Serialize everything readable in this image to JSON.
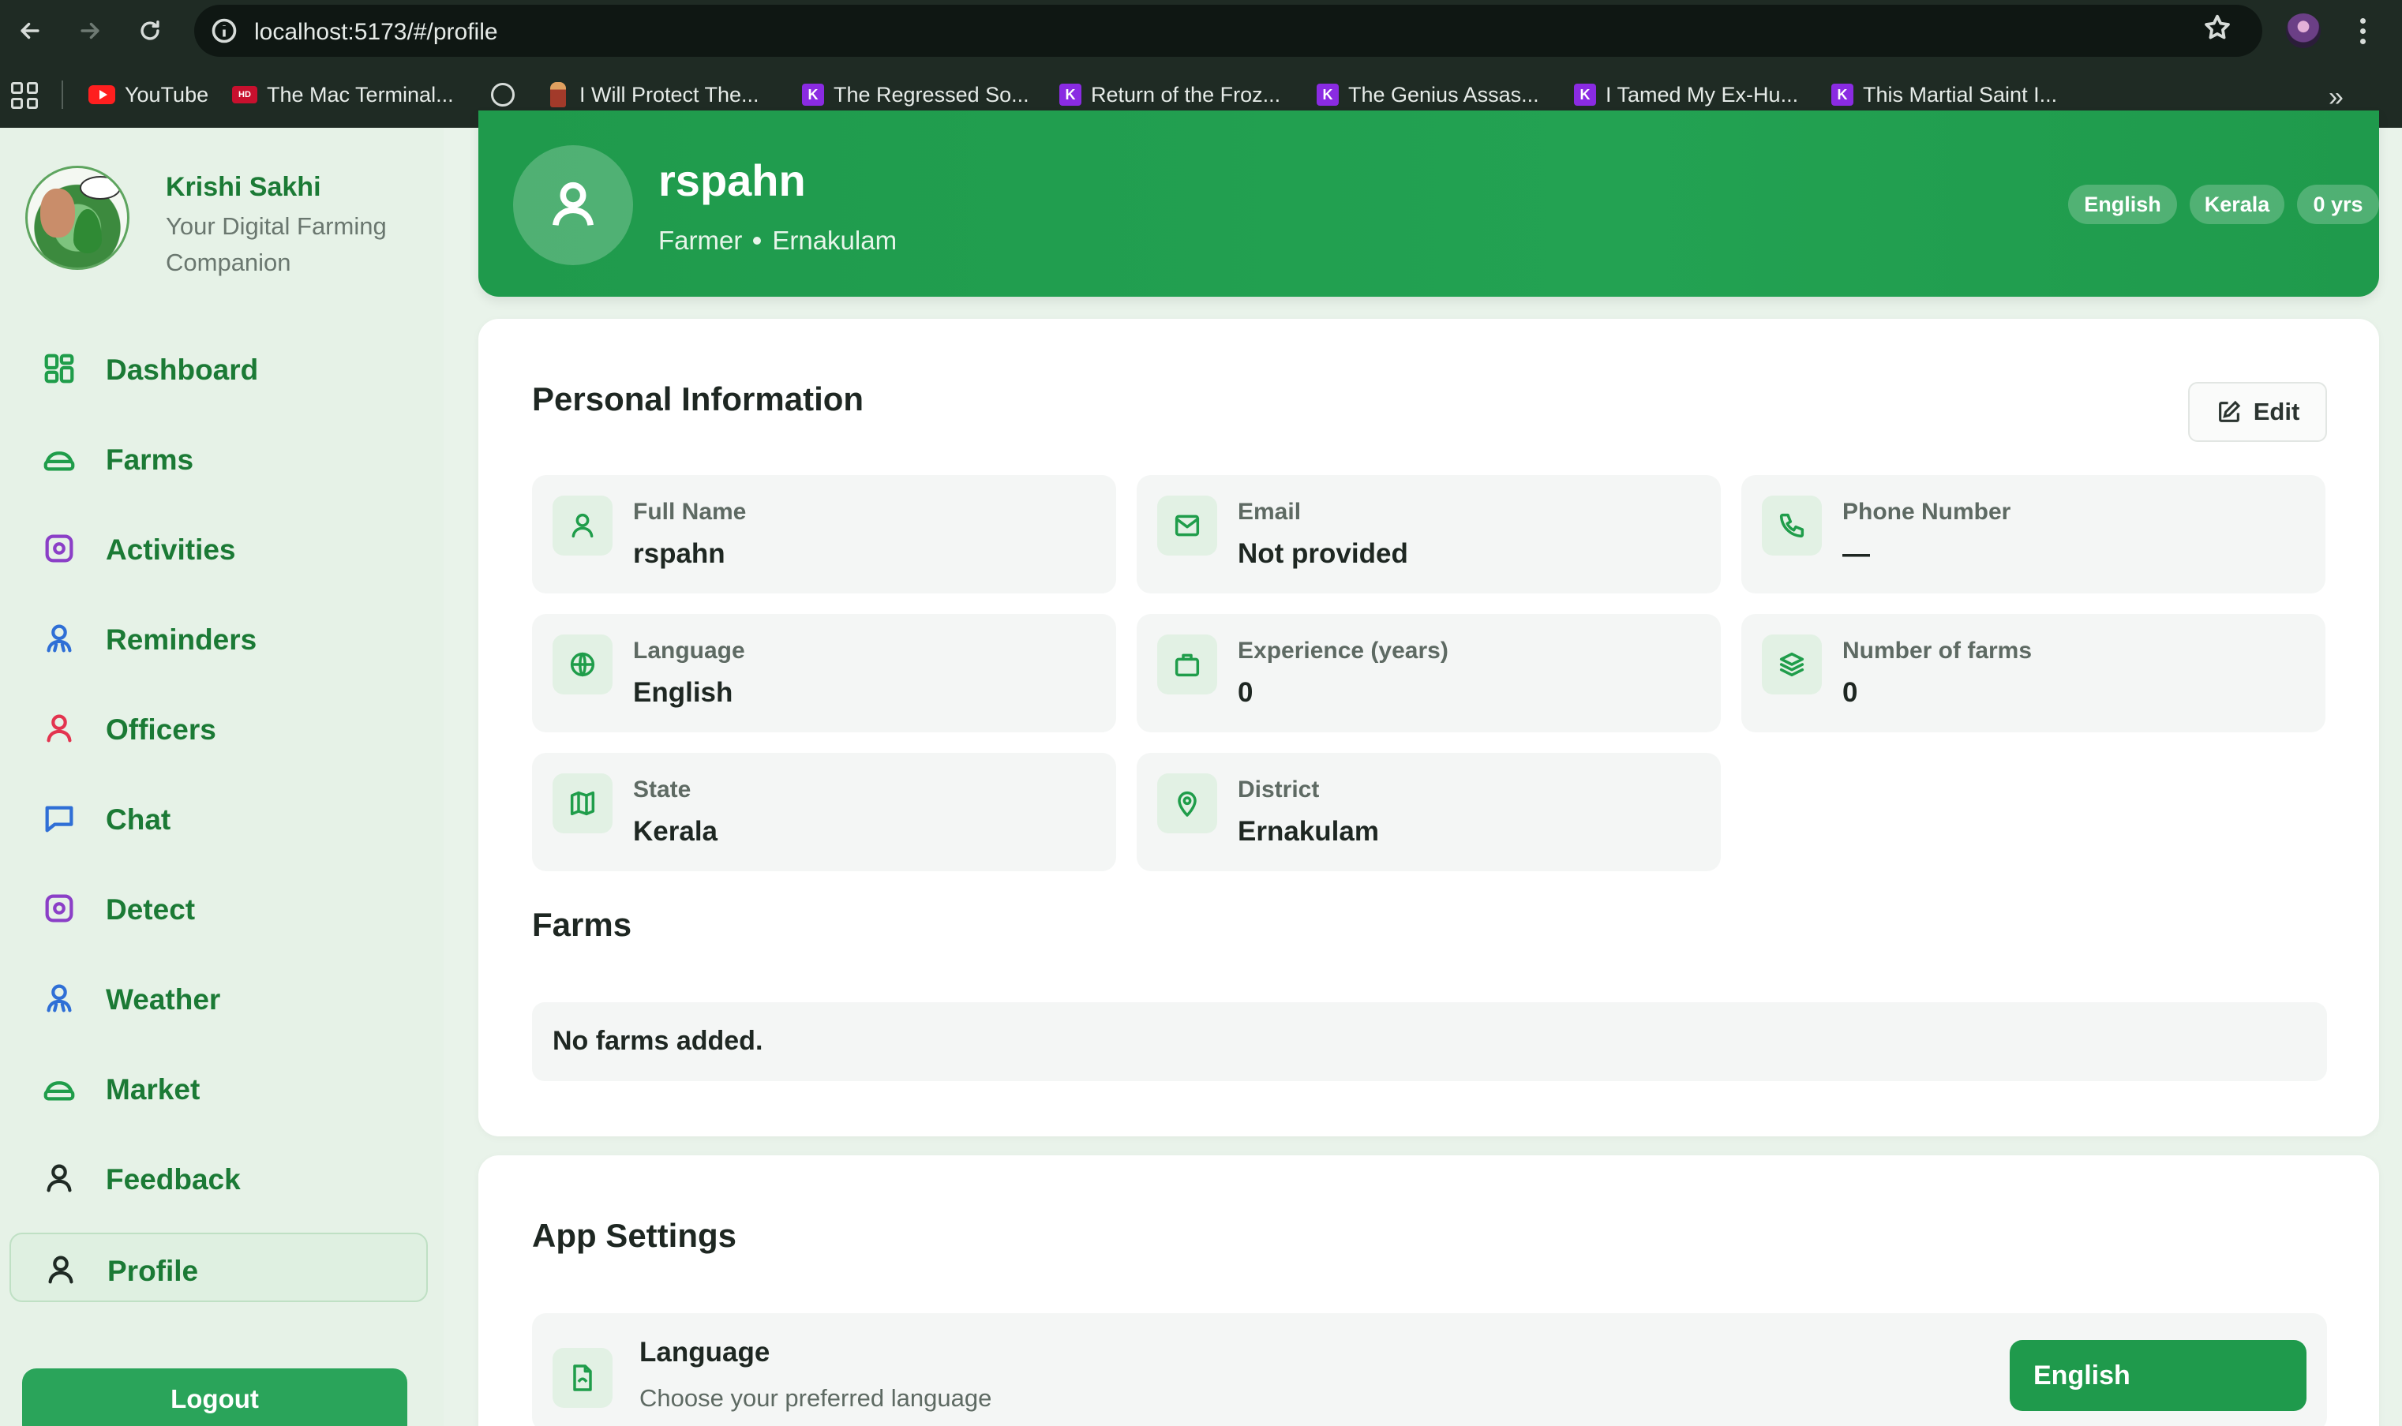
{
  "browser": {
    "url": "localhost:5173/#/profile",
    "bookmarks": [
      {
        "label": "YouTube",
        "icon": "youtube-icon"
      },
      {
        "label": "The Mac Terminal...",
        "icon": "hd-icon"
      },
      {
        "label": "",
        "icon": "globe-icon"
      },
      {
        "label": "I Will Protect The...",
        "icon": "figure-icon"
      },
      {
        "label": "The Regressed So...",
        "icon": "k-icon"
      },
      {
        "label": "Return of the Froz...",
        "icon": "k-icon"
      },
      {
        "label": "The Genius Assas...",
        "icon": "k-icon"
      },
      {
        "label": "I Tamed My Ex-Hu...",
        "icon": "k-icon"
      },
      {
        "label": "This Martial Saint I...",
        "icon": "k-icon"
      }
    ],
    "more": "»"
  },
  "sidebar": {
    "brand_name": "Krishi Sakhi",
    "brand_tagline": "Your Digital Farming Companion",
    "items": [
      {
        "label": "Dashboard",
        "icon": "dashboard-icon"
      },
      {
        "label": "Farms",
        "icon": "farm-icon"
      },
      {
        "label": "Activities",
        "icon": "activities-icon"
      },
      {
        "label": "Reminders",
        "icon": "reminders-icon"
      },
      {
        "label": "Officers",
        "icon": "officers-icon"
      },
      {
        "label": "Chat",
        "icon": "chat-icon"
      },
      {
        "label": "Detect",
        "icon": "detect-icon"
      },
      {
        "label": "Weather",
        "icon": "weather-icon"
      },
      {
        "label": "Market",
        "icon": "market-icon"
      },
      {
        "label": "Feedback",
        "icon": "feedback-icon"
      },
      {
        "label": "Profile",
        "icon": "profile-icon"
      }
    ],
    "active_item": "Profile",
    "logout_label": "Logout"
  },
  "hero": {
    "name": "rspahn",
    "role": "Farmer",
    "district": "Ernakulam",
    "pills": [
      "English",
      "Kerala",
      "0 yrs"
    ]
  },
  "personal_info": {
    "title": "Personal Information",
    "edit_label": "Edit",
    "fields": [
      {
        "label": "Full Name",
        "value": "rspahn",
        "icon": "user-icon"
      },
      {
        "label": "Email",
        "value": "Not provided",
        "icon": "mail-icon"
      },
      {
        "label": "Phone Number",
        "value": "—",
        "icon": "phone-icon"
      },
      {
        "label": "Language",
        "value": "English",
        "icon": "globe-icon"
      },
      {
        "label": "Experience (years)",
        "value": "0",
        "icon": "briefcase-icon"
      },
      {
        "label": "Number of farms",
        "value": "0",
        "icon": "layers-icon"
      },
      {
        "label": "State",
        "value": "Kerala",
        "icon": "map-icon"
      },
      {
        "label": "District",
        "value": "Ernakulam",
        "icon": "map-pin-icon"
      }
    ]
  },
  "farms": {
    "title": "Farms",
    "empty_text": "No farms added."
  },
  "app_settings": {
    "title": "App Settings",
    "language": {
      "title": "Language",
      "subtitle": "Choose your preferred language",
      "selected": "English"
    }
  },
  "colors": {
    "accent": "#1f9a4c",
    "brand_text": "#1b7a35",
    "sidebar_bg": "#e6f2e7"
  }
}
